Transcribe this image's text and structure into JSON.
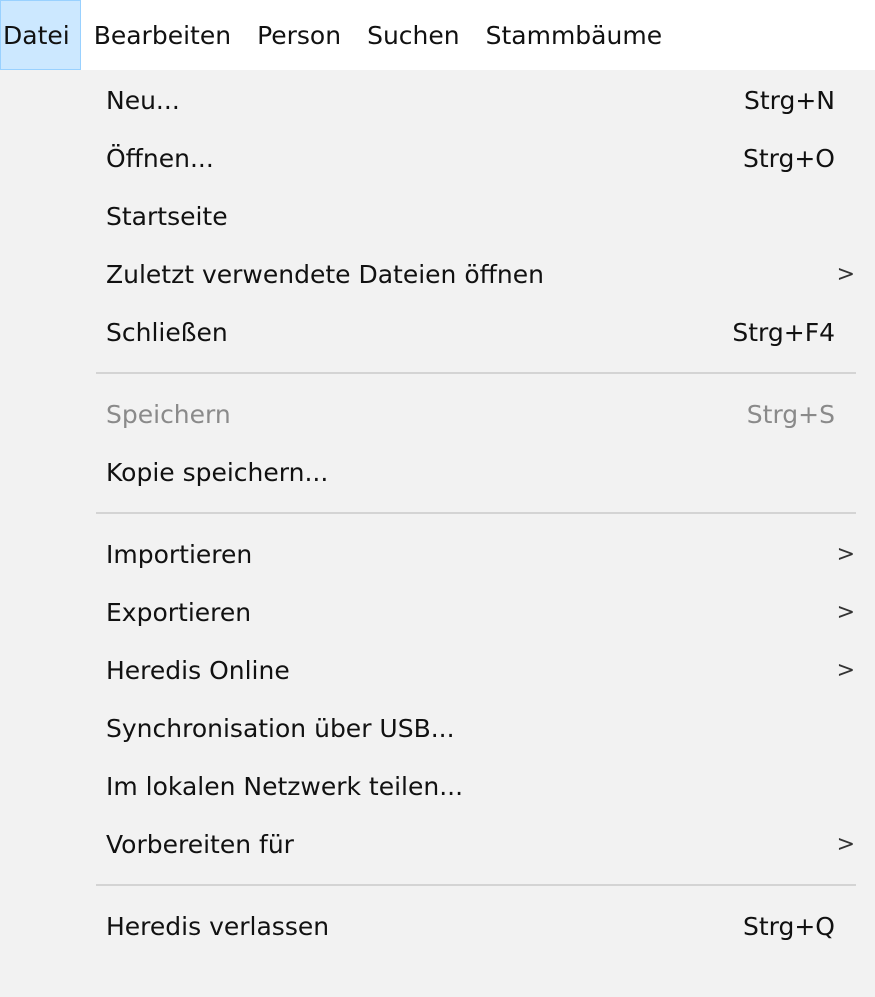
{
  "menubar": {
    "items": [
      "Datei",
      "Bearbeiten",
      "Person",
      "Suchen",
      "Stammbäume"
    ]
  },
  "menu": {
    "items": [
      {
        "label": "Neu...",
        "shortcut": "Strg+N"
      },
      {
        "label": "Öffnen...",
        "shortcut": "Strg+O"
      },
      {
        "label": "Startseite"
      },
      {
        "label": "Zuletzt verwendete Dateien öffnen",
        "submenu": true
      },
      {
        "label": "Schließen",
        "shortcut": "Strg+F4"
      },
      {
        "label": "Speichern",
        "shortcut": "Strg+S",
        "disabled": true
      },
      {
        "label": "Kopie speichern..."
      },
      {
        "label": "Importieren",
        "submenu": true
      },
      {
        "label": "Exportieren",
        "submenu": true
      },
      {
        "label": "Heredis Online",
        "submenu": true
      },
      {
        "label": "Synchronisation über USB..."
      },
      {
        "label": "Im lokalen Netzwerk teilen..."
      },
      {
        "label": "Vorbereiten für",
        "submenu": true
      },
      {
        "label": "Heredis verlassen",
        "shortcut": "Strg+Q"
      }
    ],
    "submenu_arrow": ">"
  },
  "colors": {
    "active_menu_bg": "#cce8ff",
    "active_menu_border": "#99d1ff",
    "disabled_text": "#8a8a8a",
    "menu_bg": "#f2f2f2",
    "separator": "#d4d4d4"
  }
}
